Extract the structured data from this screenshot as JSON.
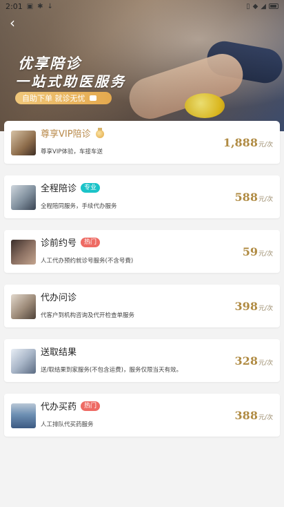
{
  "status_bar": {
    "time": "2:01"
  },
  "header": {
    "title": "优享陪诊",
    "subtitle": "一站式助医服务",
    "pill_text": "自助下单 就诊无忧"
  },
  "services": [
    {
      "name": "尊享VIP陪诊",
      "badge": "",
      "desc": "尊享VIP体验，车接车送",
      "price": "1,888",
      "unit": "元/次"
    },
    {
      "name": "全程陪诊",
      "badge": "专业",
      "desc": "全程陪同服务，手续代办服务",
      "price": "588",
      "unit": "元/次"
    },
    {
      "name": "诊前约号",
      "badge": "热门",
      "desc": "人工代办预约就诊号服务(不含号費)",
      "price": "59",
      "unit": "元/次"
    },
    {
      "name": "代办问诊",
      "badge": "",
      "desc": "代客户到机构咨询及代开检查单服务",
      "price": "398",
      "unit": "元/次"
    },
    {
      "name": "送取结果",
      "badge": "",
      "desc": "送/取结果到家服务(不包含运费)，服务仅限当天有效。",
      "price": "328",
      "unit": "元/次"
    },
    {
      "name": "代办买药",
      "badge": "热门",
      "desc": "人工排队代买药服务",
      "price": "388",
      "unit": "元/次"
    }
  ],
  "colors": {
    "price": "#b08b43",
    "badge_teal": "#1bc3c8",
    "badge_red": "#ee6b64",
    "background": "#f3f3f3"
  }
}
